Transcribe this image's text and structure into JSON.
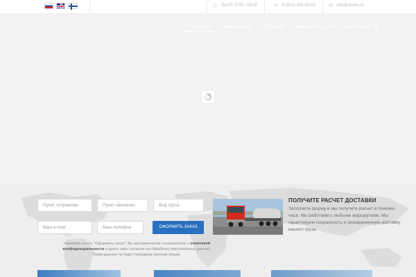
{
  "languages": [
    "ru",
    "en",
    "fi"
  ],
  "topbar": {
    "hours": "Пн-Пт: 9:00 - 18:00",
    "phone": "8 (812) 303-03-55",
    "email": "info@atrans.ru"
  },
  "nav": {
    "items": [
      "ГЛАВНАЯ",
      "О КОМПАНИИ",
      "АВТОПАРК",
      "ДОКУМЕНТАЦИЯ",
      "КОНТАКТЫ"
    ],
    "active_index": 0
  },
  "form": {
    "origin_placeholder": "Пункт отправлен",
    "destination_placeholder": "Пункт назначен",
    "cargo_placeholder": "Вид груза",
    "email_placeholder": "Ваш e-mail",
    "phone_placeholder": "Ваш телефон",
    "submit_label": "ОФОРМИТЬ ЗАКАЗ",
    "notice_part1": "Нажимая кнопку \"Оформить заказ\", Вы автоматически соглашаетесь с",
    "notice_link": "политикой конфиденциальности",
    "notice_part2": "и даете свое согласие на обработку персональных данных. Ваши данные не будут переданы третьим лицам."
  },
  "promo": {
    "title": "ПОЛУЧИТЕ РАСЧЕТ ДОСТАВКИ",
    "text": "Заполните форму и мы получите расчет в течение часа. Мы работаем с любыми маршрутами. Мы гарантируем сохранность и своевременную доставку вашего груза."
  },
  "colors": {
    "accent": "#2a6fbf",
    "hero_bg": "#f2f2f2",
    "section_bg": "#eeeeee"
  }
}
